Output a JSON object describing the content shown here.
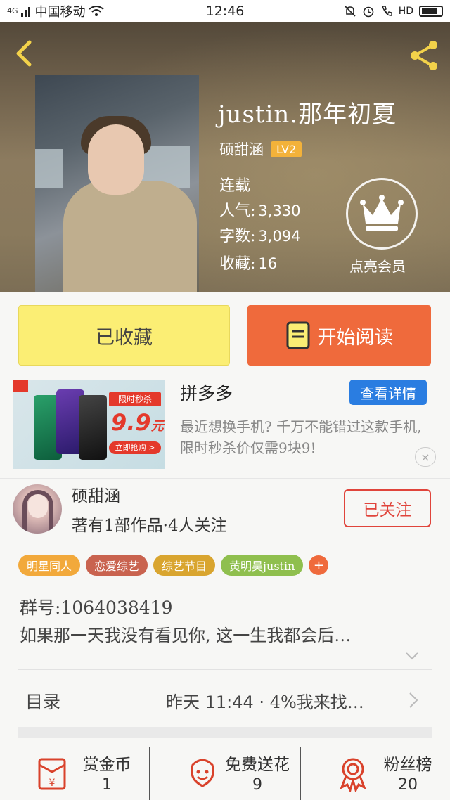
{
  "status_bar": {
    "signal": "4G",
    "carrier": "中国移动",
    "time": "12:46",
    "hd": "HD"
  },
  "book": {
    "title": "justin.那年初夏",
    "author": "硕甜涵",
    "level": "LV2",
    "status": "连载",
    "popularity_label": "人气:",
    "popularity": "3,330",
    "words_label": "字数:",
    "words": "3,094",
    "favorites_label": "收藏:",
    "favorites": "16",
    "member_label": "点亮会员"
  },
  "actions": {
    "favorited_label": "已收藏",
    "read_label": "开始阅读"
  },
  "ad": {
    "tag": "限时秒杀",
    "price": "9.9",
    "price_unit": "元",
    "cta": "立即抢购 >",
    "brand": "拼多多",
    "detail_button": "查看详情",
    "description": "最近想换手机? 千万不能错过这款手机, 限时秒杀价仅需9块9!",
    "close": "×"
  },
  "author": {
    "name": "硕甜涵",
    "works": "著有1部作品·4人关注",
    "follow_label": "已关注"
  },
  "tags": [
    {
      "label": "明星同人",
      "color": "#f2a93b"
    },
    {
      "label": "恋爱综艺",
      "color": "#c9634f"
    },
    {
      "label": "综艺节目",
      "color": "#d9a52f"
    },
    {
      "label": "黄明昊justin",
      "color": "#8fbf4e"
    }
  ],
  "tag_add": "+",
  "intro": {
    "group_no": "群号:1064038419",
    "text": "如果那一天我没有看见你, 这一生我都会后…"
  },
  "catalog": {
    "label": "目录",
    "latest_time": "昨天 11:44 · ",
    "latest_chapter": "4%我来找…"
  },
  "bottom_bar": {
    "reward_label": "赏金币",
    "reward_value": "1",
    "flower_label": "免费送花",
    "flower_value": "9",
    "fans_label": "粉丝榜",
    "fans_value": "20"
  },
  "colors": {
    "accent": "#ef6a3c",
    "fav_button": "#fbee74",
    "level_badge": "#f3b23a",
    "follow": "#e0443b",
    "ad_detail": "#2a7de1"
  }
}
